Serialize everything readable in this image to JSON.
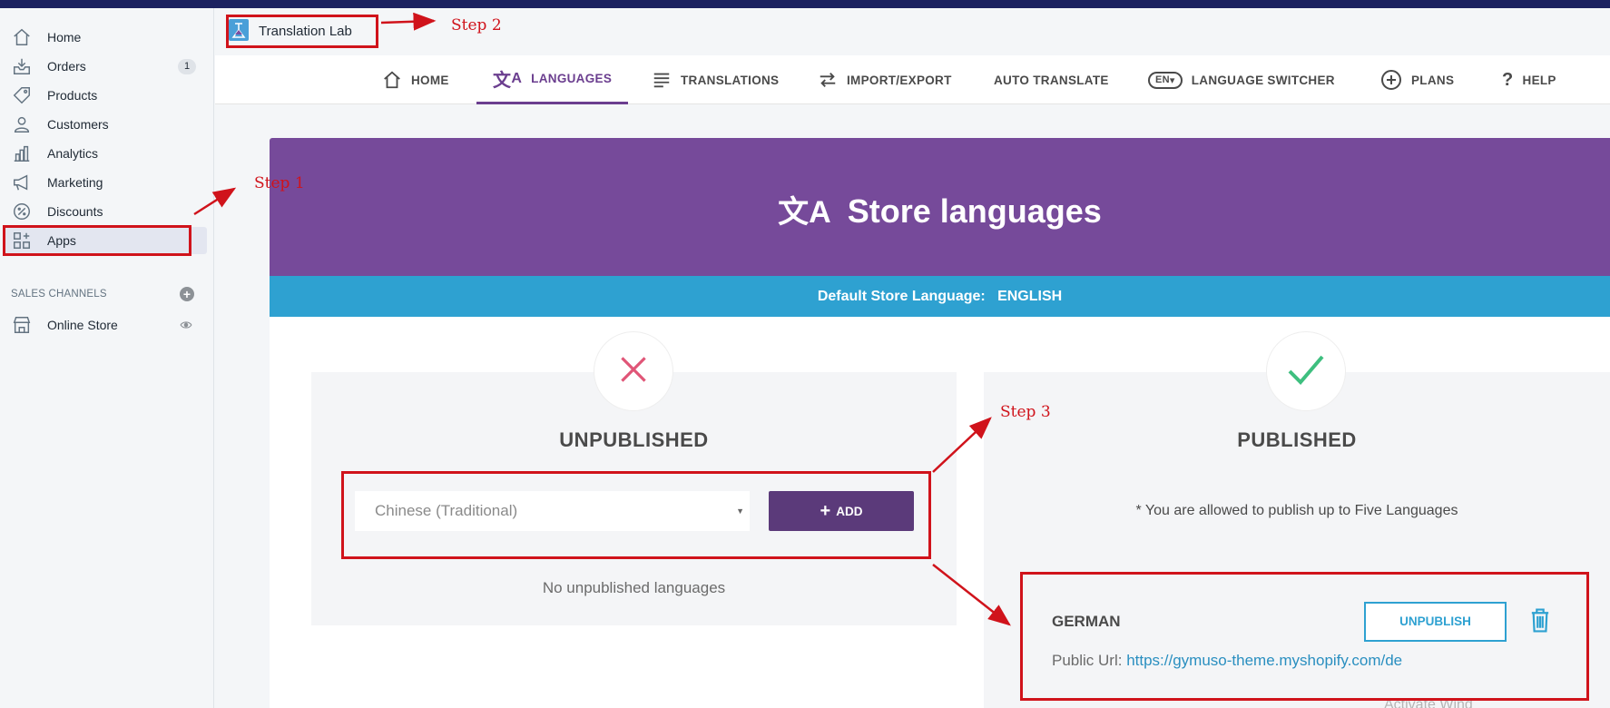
{
  "sidebar": {
    "items": [
      {
        "label": "Home",
        "icon": "home-icon"
      },
      {
        "label": "Orders",
        "icon": "orders-icon",
        "badge": "1"
      },
      {
        "label": "Products",
        "icon": "tag-icon"
      },
      {
        "label": "Customers",
        "icon": "person-icon"
      },
      {
        "label": "Analytics",
        "icon": "analytics-icon"
      },
      {
        "label": "Marketing",
        "icon": "megaphone-icon"
      },
      {
        "label": "Discounts",
        "icon": "discount-icon"
      },
      {
        "label": "Apps",
        "icon": "apps-icon"
      }
    ],
    "sales_channels_title": "SALES CHANNELS",
    "online_store": "Online Store"
  },
  "app": {
    "title": "Translation Lab",
    "tabs": [
      {
        "label": "HOME"
      },
      {
        "label": "LANGUAGES"
      },
      {
        "label": "TRANSLATIONS"
      },
      {
        "label": "IMPORT/EXPORT"
      },
      {
        "label": "AUTO TRANSLATE"
      },
      {
        "label": "LANGUAGE SWITCHER",
        "icon_text": "EN"
      },
      {
        "label": "PLANS"
      },
      {
        "label": "HELP"
      }
    ],
    "active_tab": "LANGUAGES"
  },
  "hero": {
    "title": "Store languages",
    "icon_glyph": "文A"
  },
  "default_language": {
    "label": "Default Store Language:",
    "value": "ENGLISH"
  },
  "unpublished": {
    "heading": "UNPUBLISHED",
    "select_value": "Chinese (Traditional)",
    "add_label": "ADD",
    "empty_text": "No unpublished languages"
  },
  "published": {
    "heading": "PUBLISHED",
    "note": "* You are allowed to publish up to Five Languages",
    "languages": [
      {
        "name": "GERMAN",
        "url_label": "Public Url:",
        "url": "https://gymuso-theme.myshopify.com/de",
        "unpublish_label": "UNPUBLISH"
      }
    ]
  },
  "annotations": {
    "step1": "Step 1",
    "step2": "Step 2",
    "step3": "Step 3",
    "color": "#d0131b"
  },
  "watermark": "Activate Wind"
}
